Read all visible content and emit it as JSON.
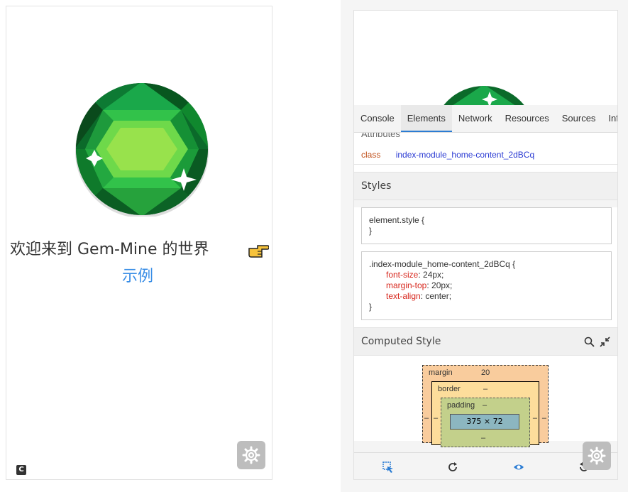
{
  "left_screen": {
    "welcome_text": "欢迎来到 Gem-Mine 的世界",
    "link_text": "示例",
    "logo_letter": "C"
  },
  "devtools": {
    "tabs": [
      "Console",
      "Elements",
      "Network",
      "Resources",
      "Sources",
      "Info"
    ],
    "active_tab": "Elements",
    "attributes_heading": "Attributes",
    "attribute": {
      "name": "class",
      "value": "index-module_home-content_2dBCq"
    },
    "styles_heading": "Styles",
    "element_style": {
      "selector": "element.style {",
      "close": "}"
    },
    "rule": {
      "selector": ".index-module_home-content_2dBCq {",
      "props": [
        {
          "name": "font-size",
          "value": "24px;"
        },
        {
          "name": "margin-top",
          "value": "20px;"
        },
        {
          "name": "text-align",
          "value": "center;"
        }
      ],
      "close": "}"
    },
    "computed_heading": "Computed Style",
    "box_model": {
      "margin_label": "margin",
      "margin_value": "20",
      "border_label": "border",
      "border_value": "–",
      "padding_label": "padding",
      "padding_value": "–",
      "content": "375 × 72",
      "dash": "–"
    }
  },
  "colors": {
    "link": "#3a8ee6",
    "active_tab_underline": "#2b7cd3",
    "attr_name": "#c0521e",
    "attr_value": "#2b3bd3",
    "css_prop": "#d7261c"
  },
  "icons": [
    "gem-image",
    "pointing-hand-icon",
    "gear-icon",
    "search-icon",
    "collapse-icon",
    "select-element-icon",
    "refresh-icon",
    "eye-icon",
    "rotate-icon"
  ]
}
